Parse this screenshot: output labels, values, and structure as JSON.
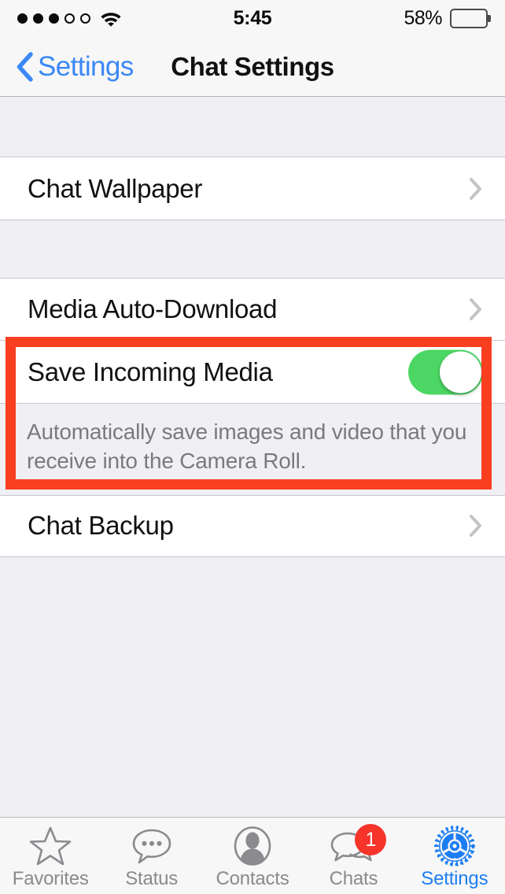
{
  "status_bar": {
    "signal_dots_filled": 3,
    "signal_dots_total": 5,
    "wifi_icon": "wifi-icon",
    "time": "5:45",
    "battery_percent": "58%",
    "battery_level": 58,
    "battery_color": "#4cd964"
  },
  "nav": {
    "back_label": "Settings",
    "back_icon": "chevron-left-icon",
    "title": "Chat Settings",
    "accent_color": "#3b88f5"
  },
  "sections": [
    {
      "rows": [
        {
          "label": "Chat Wallpaper",
          "accessory": "chevron-right-icon"
        }
      ]
    },
    {
      "rows": [
        {
          "label": "Media Auto-Download",
          "accessory": "chevron-right-icon"
        },
        {
          "label": "Save Incoming Media",
          "accessory": "toggle-switch",
          "toggle_on": true
        }
      ],
      "footer": "Automatically save images and video that you receive into the Camera Roll."
    },
    {
      "rows": [
        {
          "label": "Chat Backup",
          "accessory": "chevron-right-icon"
        }
      ]
    }
  ],
  "annotation": {
    "color": "#f93f20",
    "target": "Save Incoming Media"
  },
  "tabbar": {
    "items": [
      {
        "label": "Favorites",
        "icon": "star-icon",
        "active": false,
        "badge": null
      },
      {
        "label": "Status",
        "icon": "speech-bubble-dots-icon",
        "active": false,
        "badge": null
      },
      {
        "label": "Contacts",
        "icon": "person-icon",
        "active": false,
        "badge": null
      },
      {
        "label": "Chats",
        "icon": "chat-bubbles-icon",
        "active": false,
        "badge": "1"
      },
      {
        "label": "Settings",
        "icon": "gear-icon",
        "active": true,
        "badge": null
      }
    ],
    "active_color": "#1d7ef4",
    "inactive_color": "#8a8a8f",
    "badge_color": "#f6342a"
  }
}
